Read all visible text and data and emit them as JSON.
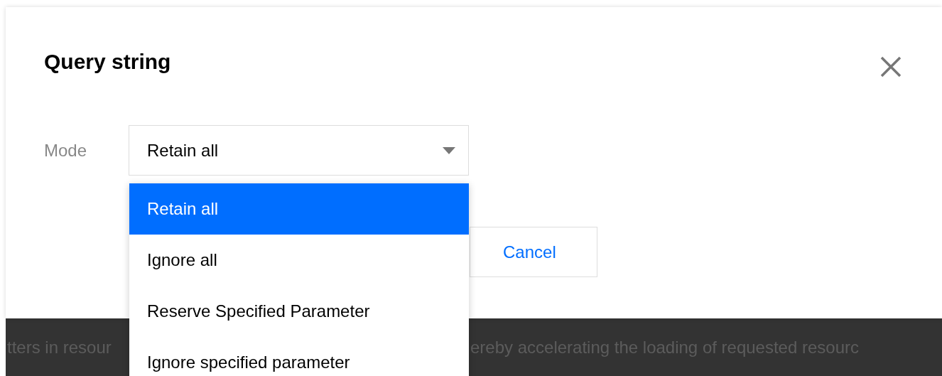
{
  "dialog": {
    "title": "Query string",
    "field": {
      "label": "Mode",
      "value": "Retain all"
    },
    "dropdown": [
      {
        "label": "Retain all",
        "selected": true
      },
      {
        "label": "Ignore all",
        "selected": false
      },
      {
        "label": "Reserve Specified Parameter",
        "selected": false
      },
      {
        "label": "Ignore specified parameter",
        "selected": false
      }
    ],
    "buttons": [
      "Cancel"
    ]
  },
  "background_text": [
    "tters in resour",
    "ereby accelerating the loading of requested resourc"
  ]
}
